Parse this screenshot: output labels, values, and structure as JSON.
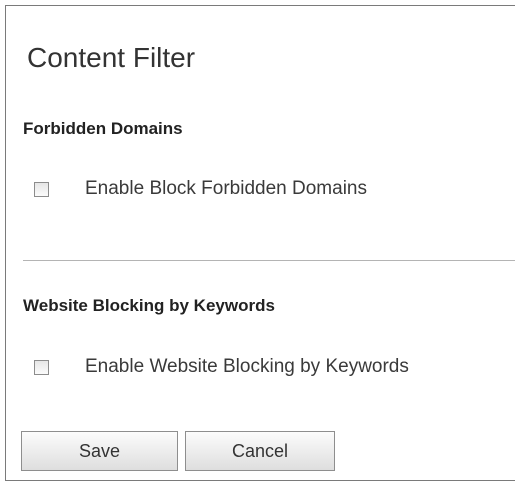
{
  "page": {
    "title": "Content Filter"
  },
  "forbidden_domains": {
    "heading": "Forbidden Domains",
    "option_label": "Enable Block Forbidden Domains",
    "checked": false
  },
  "keyword_blocking": {
    "heading": "Website Blocking by Keywords",
    "option_label": "Enable Website Blocking by Keywords",
    "checked": false
  },
  "buttons": {
    "save_label": "Save",
    "cancel_label": "Cancel"
  }
}
